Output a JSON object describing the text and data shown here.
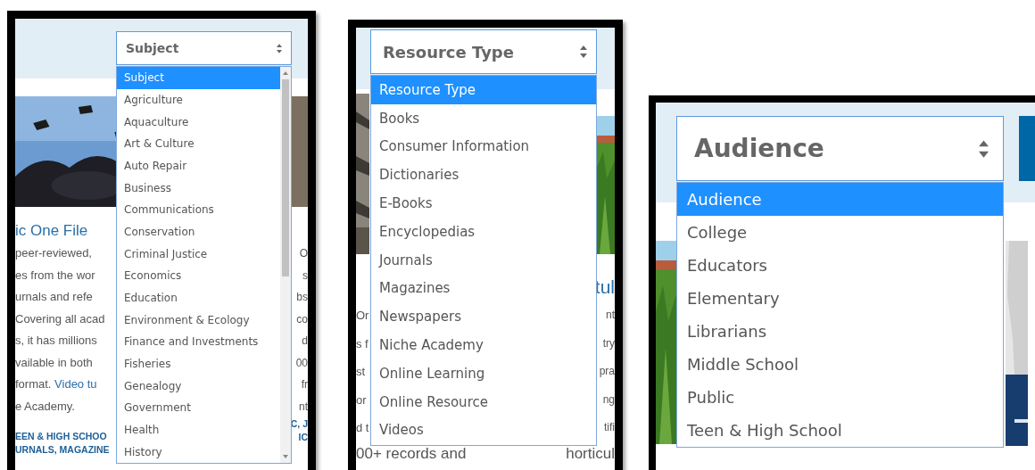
{
  "panels": [
    {
      "select": {
        "value": "Subject"
      },
      "options": [
        {
          "label": "Subject",
          "selected": true
        },
        {
          "label": "Agriculture",
          "selected": false
        },
        {
          "label": "Aquaculture",
          "selected": false
        },
        {
          "label": "Art & Culture",
          "selected": false
        },
        {
          "label": "Auto Repair",
          "selected": false
        },
        {
          "label": "Business",
          "selected": false
        },
        {
          "label": "Communications",
          "selected": false
        },
        {
          "label": "Conservation",
          "selected": false
        },
        {
          "label": "Criminal Justice",
          "selected": false
        },
        {
          "label": "Economics",
          "selected": false
        },
        {
          "label": "Education",
          "selected": false
        },
        {
          "label": "Environment & Ecology",
          "selected": false
        },
        {
          "label": "Finance and Investments",
          "selected": false
        },
        {
          "label": "Fisheries",
          "selected": false
        },
        {
          "label": "Genealogy",
          "selected": false
        },
        {
          "label": "Government",
          "selected": false
        },
        {
          "label": "Health",
          "selected": false
        },
        {
          "label": "History",
          "selected": false
        }
      ],
      "left_lines": [
        {
          "kind": "heading",
          "text": "ic One File"
        },
        {
          "kind": "body",
          "text": "peer-reviewed,"
        },
        {
          "kind": "body",
          "text": "es from the wor"
        },
        {
          "kind": "body",
          "text": "urnals and refe"
        },
        {
          "kind": "body",
          "text": "Covering all acad"
        },
        {
          "kind": "body",
          "text": "s, it has millions"
        },
        {
          "kind": "body",
          "text": "vailable in both"
        },
        {
          "kind": "body",
          "text": "format. ",
          "link": "Video tu"
        },
        {
          "kind": "body",
          "text": "e Academy."
        },
        {
          "kind": "tags",
          "text": "EEN & HIGH SCHOO"
        },
        {
          "kind": "tags",
          "text": "URNALS, MAGAZINE"
        }
      ],
      "right_lines": [
        {
          "kind": "body",
          "text": "O"
        },
        {
          "kind": "body",
          "text": "s"
        },
        {
          "kind": "body",
          "text": "bs"
        },
        {
          "kind": "body",
          "text": "co"
        },
        {
          "kind": "body",
          "text": "d"
        },
        {
          "kind": "body",
          "text": "00"
        },
        {
          "kind": "body",
          "text": "fr"
        },
        {
          "kind": "body",
          "text": "nt"
        },
        {
          "kind": "tags",
          "text": "C, J"
        },
        {
          "kind": "tags",
          "text": "IC"
        }
      ]
    },
    {
      "select": {
        "value": "Resource Type"
      },
      "options": [
        {
          "label": "Resource Type",
          "selected": true
        },
        {
          "label": "Books",
          "selected": false
        },
        {
          "label": "Consumer Information",
          "selected": false
        },
        {
          "label": "Dictionaries",
          "selected": false
        },
        {
          "label": "E-Books",
          "selected": false
        },
        {
          "label": "Encyclopedias",
          "selected": false
        },
        {
          "label": "Journals",
          "selected": false
        },
        {
          "label": "Magazines",
          "selected": false
        },
        {
          "label": "Newspapers",
          "selected": false
        },
        {
          "label": "Niche Academy",
          "selected": false
        },
        {
          "label": "Online Learning",
          "selected": false
        },
        {
          "label": "Online Resource",
          "selected": false
        },
        {
          "label": "Videos",
          "selected": false
        }
      ],
      "left_lines": [
        {
          "kind": "body",
          "text": "Or"
        },
        {
          "kind": "body",
          "text": "s f"
        },
        {
          "kind": "body",
          "text": "st"
        },
        {
          "kind": "body",
          "text": "or"
        },
        {
          "kind": "body",
          "text": "d t"
        }
      ],
      "right_lines": [
        {
          "kind": "heading",
          "text": "tul"
        },
        {
          "kind": "body",
          "text": "nt"
        },
        {
          "kind": "body",
          "text": "try"
        },
        {
          "kind": "body",
          "text": "pra"
        },
        {
          "kind": "body",
          "text": "ng"
        },
        {
          "kind": "body",
          "text": "tifi"
        }
      ],
      "bottom_line": {
        "left": "00+ records and",
        "right": "horticul"
      }
    },
    {
      "select": {
        "value": "Audience"
      },
      "options": [
        {
          "label": "Audience",
          "selected": true
        },
        {
          "label": "College",
          "selected": false
        },
        {
          "label": "Educators",
          "selected": false
        },
        {
          "label": "Elementary",
          "selected": false
        },
        {
          "label": "Librarians",
          "selected": false
        },
        {
          "label": "Middle School",
          "selected": false
        },
        {
          "label": "Public",
          "selected": false
        },
        {
          "label": "Teen & High School",
          "selected": false
        }
      ]
    }
  ]
}
